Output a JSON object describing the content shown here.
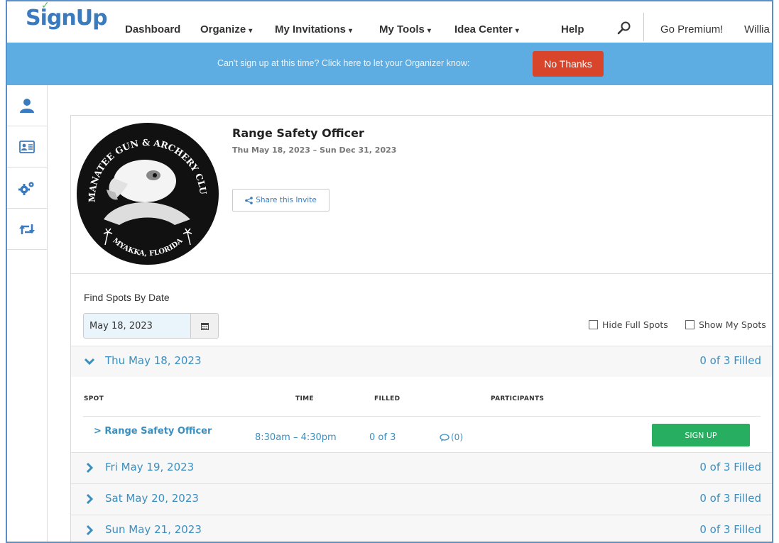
{
  "nav": {
    "logo": "SignUp",
    "items": [
      {
        "label": "Dashboard",
        "dropdown": false
      },
      {
        "label": "Organize",
        "dropdown": true
      },
      {
        "label": "My Invitations",
        "dropdown": true
      },
      {
        "label": "My Tools",
        "dropdown": true
      },
      {
        "label": "Idea Center",
        "dropdown": true
      },
      {
        "label": "Help",
        "dropdown": false
      }
    ],
    "go_premium": "Go Premium!",
    "user": "Willia"
  },
  "banner": {
    "text": "Can't sign up at this time? Click here to let your Organizer know:",
    "button": "No Thanks",
    "bg_color": "#5dade2",
    "button_color": "#d9452b"
  },
  "siderail": [
    "person-icon",
    "contact-card-icon",
    "gears-icon",
    "retweet-icon"
  ],
  "event": {
    "emblem_text_top": "MANATEE GUN & ARCHERY CLUB",
    "emblem_text_bottom": "MYAKKA, FLORIDA",
    "title": "Range Safety Officer",
    "dates": "Thu May 18, 2023 – Sun Dec 31, 2023",
    "share_label": "Share this Invite"
  },
  "filter": {
    "find_label": "Find Spots By Date",
    "date_value": "May 18, 2023",
    "hide_full": "Hide Full Spots",
    "show_mine": "Show My Spots"
  },
  "days": [
    {
      "label": "Thu May 18, 2023",
      "filled": "0 of 3 Filled",
      "expanded": true
    },
    {
      "label": "Fri May 19, 2023",
      "filled": "0 of 3 Filled",
      "expanded": false
    },
    {
      "label": "Sat May 20, 2023",
      "filled": "0 of 3 Filled",
      "expanded": false
    },
    {
      "label": "Sun May 21, 2023",
      "filled": "0 of 3 Filled",
      "expanded": false
    }
  ],
  "table": {
    "headers": {
      "spot": "SPOT",
      "time": "TIME",
      "filled": "FILLED",
      "participants": "PARTICIPANTS"
    },
    "rows": [
      {
        "spot": "Range Safety Officer",
        "time": "8:30am – 4:30pm",
        "filled": "0 of 3",
        "comments": "(0)",
        "button": "SIGN UP"
      }
    ]
  },
  "colors": {
    "accent_blue": "#3a8fc0",
    "logo_blue": "#3a7bbf",
    "signup_green": "#27ae60"
  }
}
